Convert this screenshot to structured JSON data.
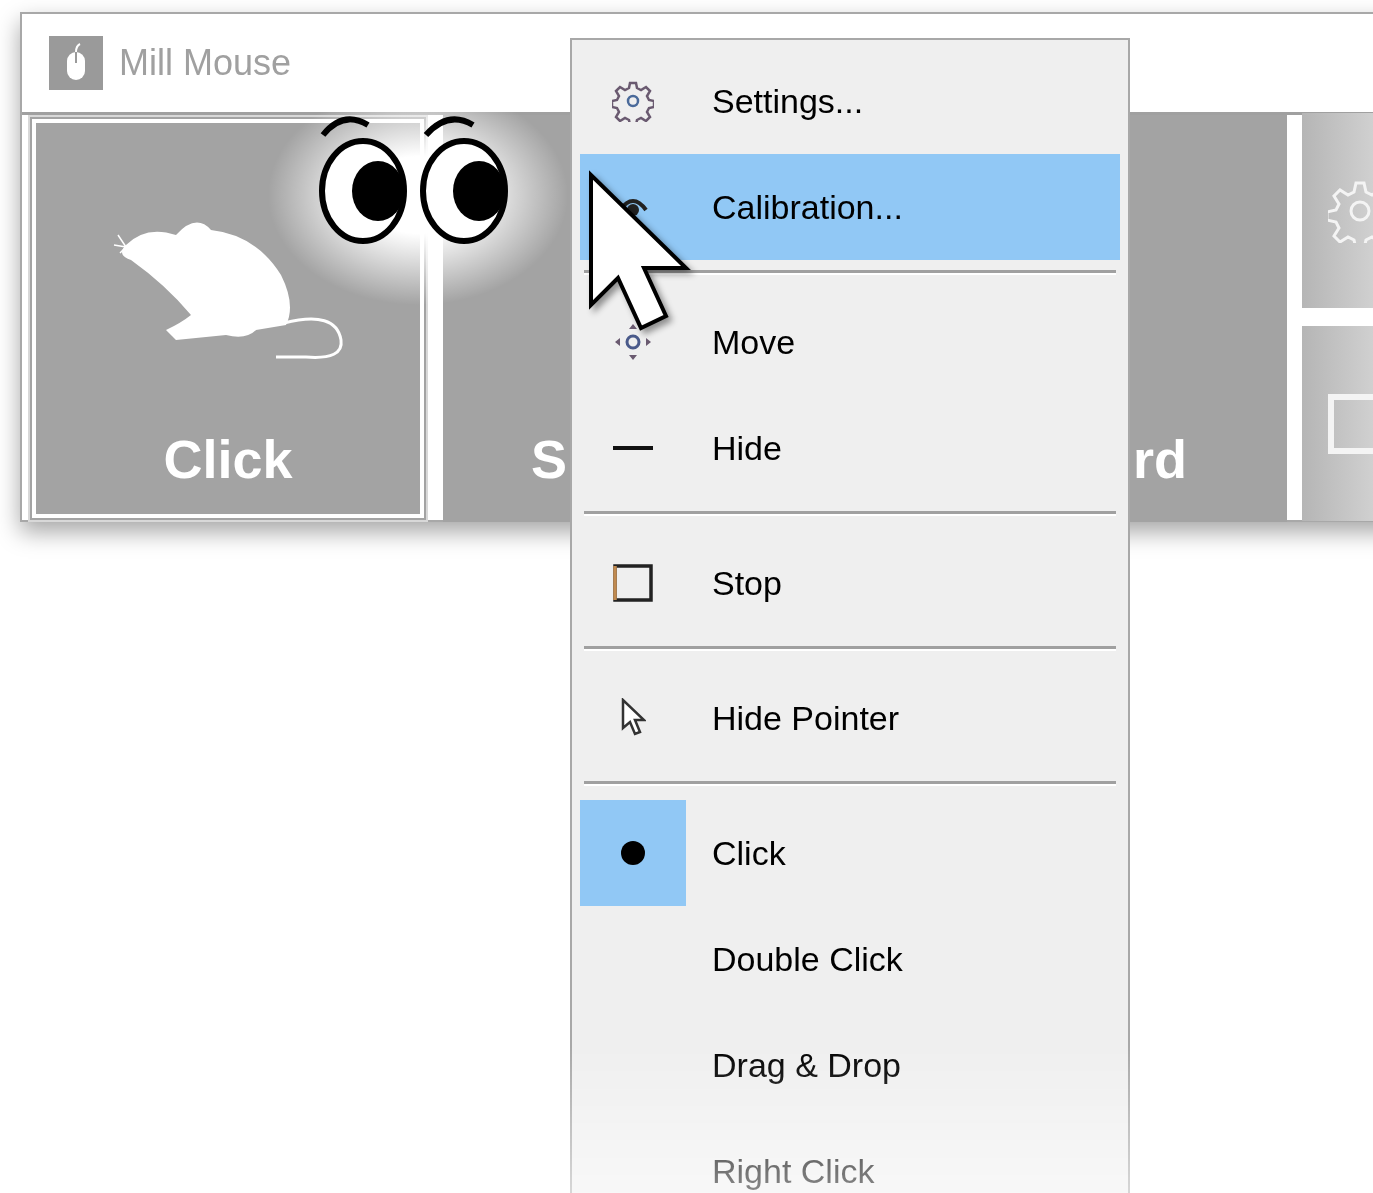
{
  "window": {
    "title": "Mill Mouse"
  },
  "tiles": [
    {
      "label": "Click",
      "selected": true
    },
    {
      "label": "S",
      "selected": false
    },
    {
      "label": "rd",
      "selected": false
    }
  ],
  "menu": [
    {
      "kind": "item",
      "label": "Settings...",
      "selected": false,
      "checked": false
    },
    {
      "kind": "item",
      "label": "Calibration...",
      "selected": true,
      "checked": false
    },
    {
      "kind": "separator"
    },
    {
      "kind": "item",
      "label": "Move",
      "selected": false,
      "checked": false
    },
    {
      "kind": "item",
      "label": "Hide",
      "selected": false,
      "checked": false
    },
    {
      "kind": "separator"
    },
    {
      "kind": "item",
      "label": "Stop",
      "selected": false,
      "checked": false
    },
    {
      "kind": "separator"
    },
    {
      "kind": "item",
      "label": "Hide Pointer",
      "selected": false,
      "checked": false
    },
    {
      "kind": "separator"
    },
    {
      "kind": "item",
      "label": "Click",
      "selected": false,
      "checked": true
    },
    {
      "kind": "item",
      "label": "Double Click",
      "selected": false,
      "checked": false
    },
    {
      "kind": "item",
      "label": "Drag & Drop",
      "selected": false,
      "checked": false
    },
    {
      "kind": "item",
      "label": "Right Click",
      "selected": false,
      "checked": false
    }
  ]
}
